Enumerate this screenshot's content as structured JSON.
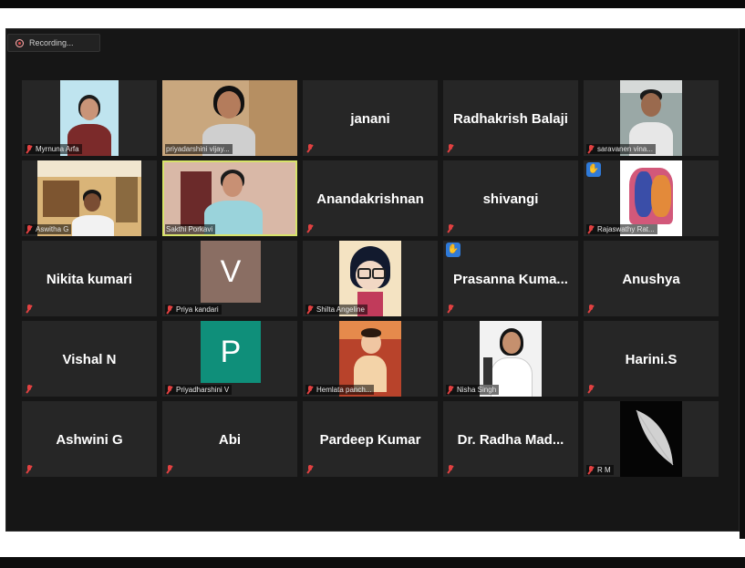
{
  "recording": {
    "label": "Recording..."
  },
  "participants": [
    {
      "name": "Myrnuna Arfa"
    },
    {
      "name": "priyadarshini vijay..."
    },
    {
      "name": "janani"
    },
    {
      "name": "Radhakrish Balaji"
    },
    {
      "name": "saravanen vina..."
    },
    {
      "name": "Aswitha G"
    },
    {
      "name": "Sakthi Porkavi"
    },
    {
      "name": "Anandakrishnan"
    },
    {
      "name": "shivangi"
    },
    {
      "name": "Rajaswathy Rat..."
    },
    {
      "name": "Nikita kumari"
    },
    {
      "name": "Priya kandari",
      "initial": "V",
      "avatar_color": "#8a6e63"
    },
    {
      "name": "Shilta Angeline"
    },
    {
      "name": "Prasanna  Kuma..."
    },
    {
      "name": "Anushya"
    },
    {
      "name": "Vishal N"
    },
    {
      "name": "Priyadharshini V",
      "initial": "P",
      "avatar_color": "#0f8f7a"
    },
    {
      "name": "Hemlata panch..."
    },
    {
      "name": "Nisha Singh"
    },
    {
      "name": "Harini.S"
    },
    {
      "name": "Ashwini G"
    },
    {
      "name": "Abi"
    },
    {
      "name": "Pardeep Kumar"
    },
    {
      "name": "Dr. Radha  Mad..."
    },
    {
      "name": "R M"
    }
  ],
  "colors": {
    "stage": "#161616",
    "tile": "#262626",
    "active_border": "#d7e36a",
    "muted_mic": "#e24141",
    "raise_hand": "#2f7ad9"
  },
  "icons": {
    "muted": "muted-mic-icon",
    "hand": "raised-hand-icon",
    "recording": "recording-dot-icon"
  }
}
